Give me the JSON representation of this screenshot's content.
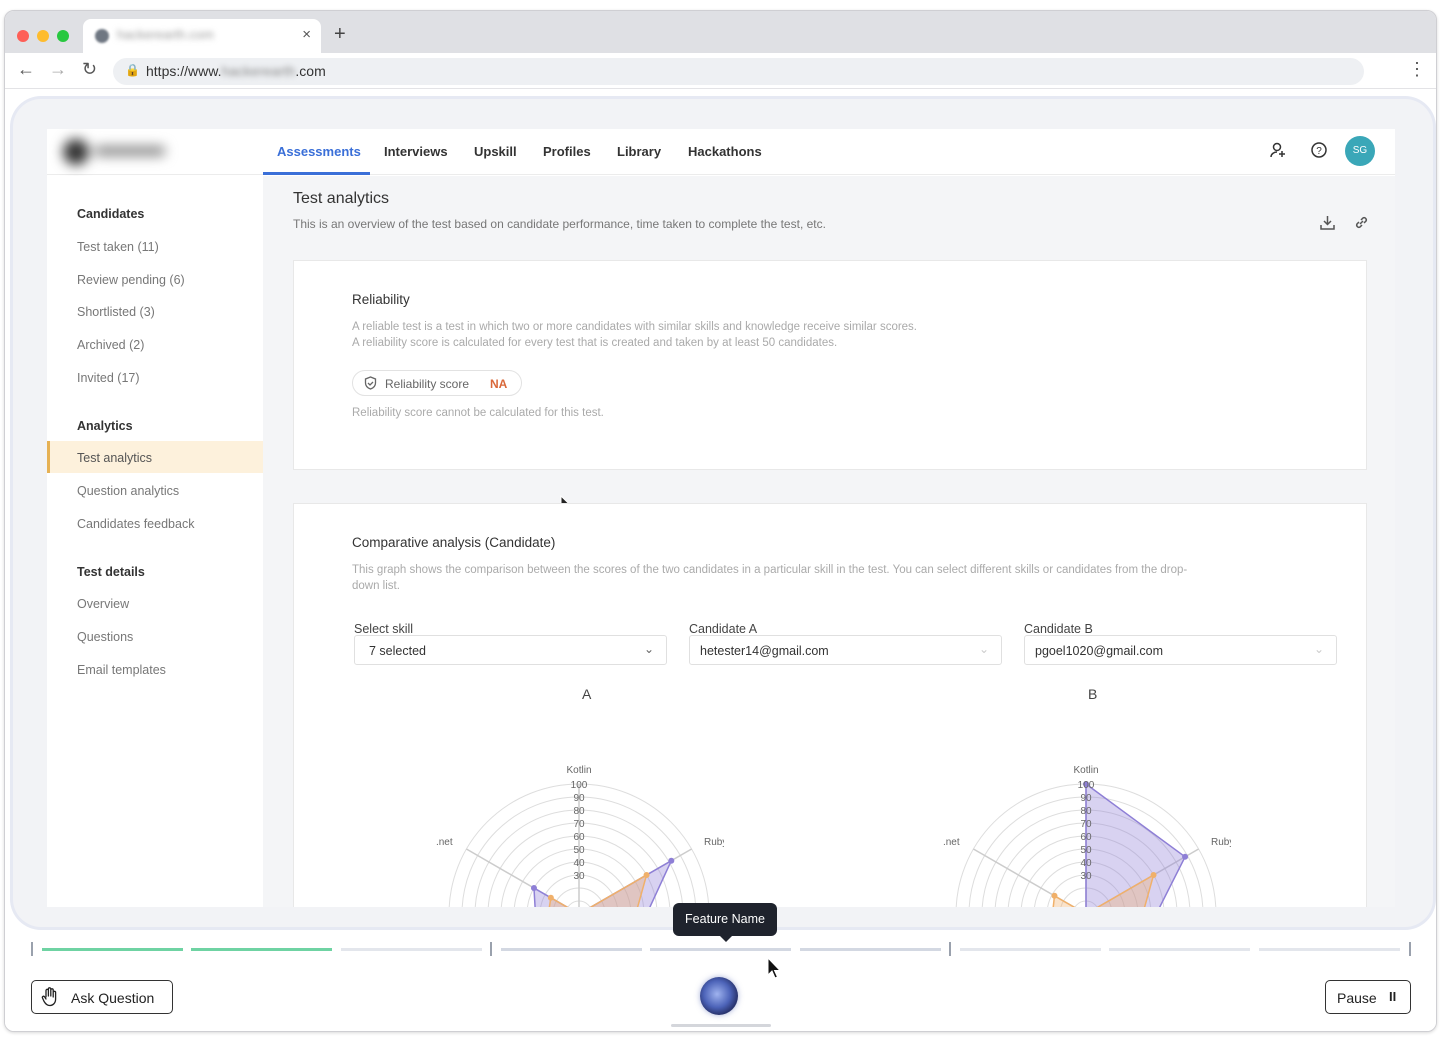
{
  "browser": {
    "tab_title": "hackerearth.com",
    "url_prefix": "https://www.",
    "url_host": "hackerearth",
    "url_suffix": ".com",
    "new_tab": "+",
    "close_tab": "×"
  },
  "nav": {
    "tabs": [
      "Assessments",
      "Interviews",
      "Upskill",
      "Profiles",
      "Library",
      "Hackathons"
    ],
    "active_tab": "Assessments",
    "avatar_initials": "SG"
  },
  "sidebar": {
    "sections": [
      {
        "heading": "Candidates",
        "items": [
          "Test taken (11)",
          "Review pending (6)",
          "Shortlisted (3)",
          "Archived (2)",
          "Invited (17)"
        ]
      },
      {
        "heading": "Analytics",
        "items": [
          "Test analytics",
          "Question analytics",
          "Candidates feedback"
        ]
      },
      {
        "heading": "Test details",
        "items": [
          "Overview",
          "Questions",
          "Email templates"
        ]
      }
    ],
    "selected_item": "Test analytics"
  },
  "page": {
    "title": "Test analytics",
    "subtitle": "This is an overview of the test based on candidate performance, time taken to complete the test, etc."
  },
  "reliability": {
    "title": "Reliability",
    "desc_line1": "A reliable test is a test in which two or more candidates with similar skills and knowledge receive similar scores.",
    "desc_line2": "A reliability score is calculated for every test that is created and taken by at least 50 candidates.",
    "score_label": "Reliability score",
    "score_value": "NA",
    "note": "Reliability score cannot be calculated for this test."
  },
  "comparative": {
    "title": "Comparative analysis (Candidate)",
    "desc_line1": "This graph shows the comparison between the scores of the two candidates in a particular skill in the test. You can select different skills or candidates from the drop-",
    "desc_line2": "down list.",
    "select_skill_label": "Select skill",
    "select_skill_value": "7 selected",
    "candidate_a_label": "Candidate A",
    "candidate_a_value": "hetester14@gmail.com",
    "candidate_b_label": "Candidate B",
    "candidate_b_value": "pgoel1020@gmail.com",
    "chart_a_label": "A",
    "chart_b_label": "B"
  },
  "chart_data": [
    {
      "type": "radar",
      "title": "A",
      "axes": [
        "Kotlin",
        "Ruby",
        ".net"
      ],
      "ticks": [
        100,
        90,
        80,
        70,
        60,
        50,
        40,
        30
      ],
      "rlim": [
        0,
        100
      ],
      "series": [
        {
          "values": {
            "Kotlin": 0,
            "Ruby": 82,
            ".net": 40
          },
          "color": "#8e7fd6"
        },
        {
          "values": {
            "Kotlin": 0,
            "Ruby": 60,
            ".net": 25
          },
          "color": "#f0b06a"
        }
      ]
    },
    {
      "type": "radar",
      "title": "B",
      "axes": [
        "Kotlin",
        "Ruby",
        ".net"
      ],
      "ticks": [
        100,
        90,
        80,
        70,
        60,
        50,
        40,
        30
      ],
      "rlim": [
        0,
        100
      ],
      "series": [
        {
          "values": {
            "Kotlin": 100,
            "Ruby": 88,
            ".net": 0
          },
          "color": "#8e7fd6"
        },
        {
          "values": {
            "Kotlin": 0,
            "Ruby": 60,
            ".net": 28
          },
          "color": "#f0b06a"
        }
      ]
    }
  ],
  "player": {
    "tooltip": "Feature Name",
    "ask_question": "Ask Question",
    "pause": "Pause",
    "pause_icon": "II"
  },
  "colors": {
    "accent": "#3a6fd8",
    "na": "#d9683a",
    "progress_done": "#6fd3a3"
  }
}
